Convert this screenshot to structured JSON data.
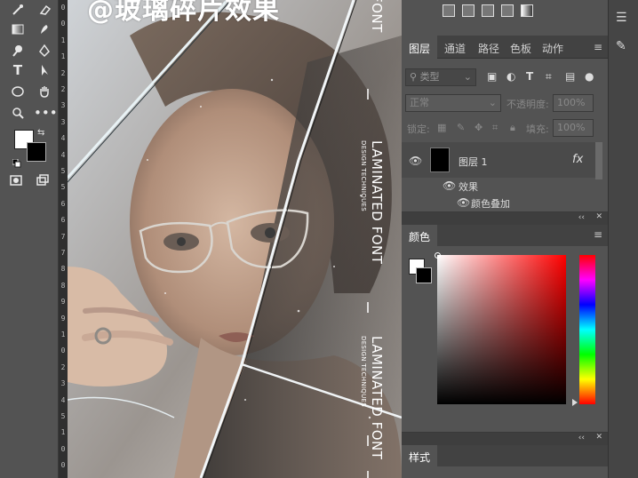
{
  "overlay": {
    "title": "@玻璃碎片效果"
  },
  "poster": {
    "line1": "LAMINATED FONT",
    "line2": "DESIGN TECHNIQUES",
    "top_fragment": "FONT"
  },
  "ruler": {
    "ticks": [
      "0",
      "0",
      "1",
      "1",
      "2",
      "2",
      "3",
      "3",
      "4",
      "4",
      "5",
      "5",
      "6",
      "6",
      "7",
      "7",
      "8",
      "8",
      "9",
      "9",
      "1",
      "0",
      "2",
      "3",
      "4",
      "5",
      "1",
      "0",
      "0"
    ]
  },
  "layers_panel": {
    "tabs": [
      "图层",
      "通道",
      "路径",
      "色板",
      "动作"
    ],
    "filter_label": "类型",
    "blend_mode": "正常",
    "opacity_label": "不透明度:",
    "opacity_value": "100%",
    "lock_label": "锁定:",
    "fill_label": "填充:",
    "fill_value": "100%",
    "layer_name": "图层 1",
    "fx_label": "fx",
    "effects_label": "效果",
    "effect_item": "颜色叠加"
  },
  "color_panel": {
    "title": "颜色"
  },
  "styles_panel": {
    "title": "样式"
  },
  "colors": {
    "foreground": "#ffffff",
    "background": "#000000",
    "panel_bg": "#535353",
    "tab_bar": "#424242"
  }
}
